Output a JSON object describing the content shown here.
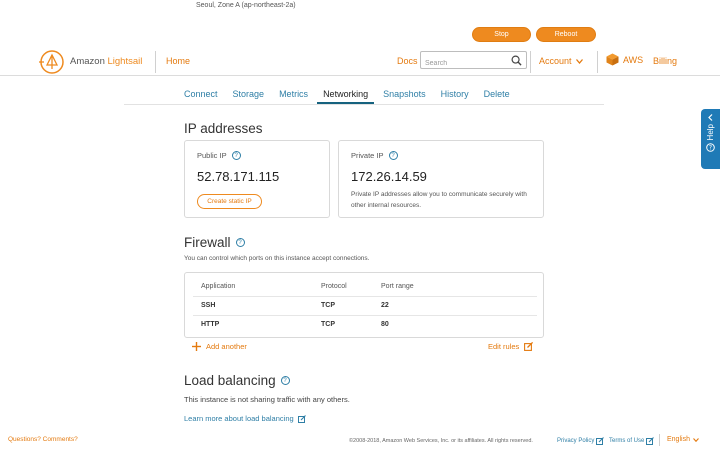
{
  "instance": {
    "zone": "Seoul, Zone A (ap-northeast-2a)",
    "stop_label": "Stop",
    "reboot_label": "Reboot"
  },
  "header": {
    "brand_prefix": "Amazon ",
    "brand_name": "Lightsail",
    "home": "Home",
    "docs": "Docs",
    "search_placeholder": "Search",
    "account": "Account",
    "aws": "AWS",
    "billing": "Billing"
  },
  "tabs": [
    {
      "label": "Connect"
    },
    {
      "label": "Storage"
    },
    {
      "label": "Metrics"
    },
    {
      "label": "Networking",
      "active": true
    },
    {
      "label": "Snapshots"
    },
    {
      "label": "History"
    },
    {
      "label": "Delete"
    }
  ],
  "ip": {
    "title": "IP addresses",
    "public_label": "Public IP",
    "public_ip": "52.78.171.115",
    "create_static": "Create static IP",
    "private_label": "Private IP",
    "private_ip": "172.26.14.59",
    "private_desc": "Private IP addresses allow you to communicate securely with other internal resources."
  },
  "firewall": {
    "title": "Firewall",
    "description": "You can control which ports on this instance accept connections.",
    "columns": [
      "Application",
      "Protocol",
      "Port range"
    ],
    "rows": [
      [
        "SSH",
        "TCP",
        "22"
      ],
      [
        "HTTP",
        "TCP",
        "80"
      ]
    ],
    "add_another": "Add another",
    "edit_rules": "Edit rules"
  },
  "load_balancing": {
    "title": "Load balancing",
    "description": "This instance is not sharing traffic with any others.",
    "learn_more": "Learn more about load balancing"
  },
  "footer": {
    "questions": "Questions? Comments?",
    "copyright": "©2008-2018, Amazon Web Services, Inc. or its affiliates. All rights reserved.",
    "privacy": "Privacy Policy",
    "terms": "Terms of Use",
    "language": "English"
  },
  "help_tab": "Help",
  "colors": {
    "accent_orange": "#ee8a1f",
    "link_blue": "#2f7fa6",
    "help_blue": "#1f7ab6"
  }
}
